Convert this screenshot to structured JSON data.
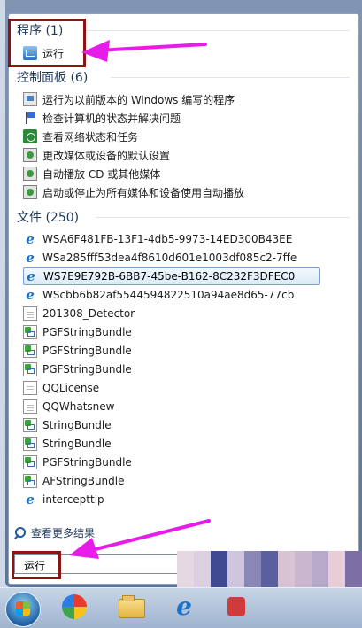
{
  "sections": {
    "programs": {
      "header": "程序 (1)",
      "items": [
        {
          "label": "运行",
          "icon": "run-icon"
        }
      ]
    },
    "control_panel": {
      "header": "控制面板 (6)",
      "items": [
        {
          "label": "运行为以前版本的 Windows 编写的程序",
          "icon": "compat-program-icon"
        },
        {
          "label": "检查计算机的状态并解决问题",
          "icon": "action-center-flag-icon"
        },
        {
          "label": "查看网络状态和任务",
          "icon": "network-icon"
        },
        {
          "label": "更改媒体或设备的默认设置",
          "icon": "autoplay-icon"
        },
        {
          "label": "自动播放 CD 或其他媒体",
          "icon": "autoplay-icon"
        },
        {
          "label": "启动或停止为所有媒体和设备使用自动播放",
          "icon": "autoplay-icon"
        }
      ]
    },
    "files": {
      "header": "文件 (250)",
      "items": [
        {
          "label": "WSA6F481FB-13F1-4db5-9973-14ED300B43EE",
          "icon": "ie-file-icon"
        },
        {
          "label": "WSa285fff53dea4f8610d601e1003df085c2-7ffe",
          "icon": "ie-file-icon"
        },
        {
          "label": "WS7E9E792B-6BB7-45be-B162-8C232F3DFEC0",
          "icon": "ie-file-icon"
        },
        {
          "label": "WScbb6b82af5544594822510a94ae8d65-77cb",
          "icon": "ie-file-icon"
        },
        {
          "label": "201308_Detector",
          "icon": "document-icon"
        },
        {
          "label": "PGFStringBundle",
          "icon": "xml-file-icon"
        },
        {
          "label": "PGFStringBundle",
          "icon": "xml-file-icon"
        },
        {
          "label": "PGFStringBundle",
          "icon": "xml-file-icon"
        },
        {
          "label": "QQLicense",
          "icon": "document-icon"
        },
        {
          "label": "QQWhatsnew",
          "icon": "document-icon"
        },
        {
          "label": "StringBundle",
          "icon": "xml-file-icon"
        },
        {
          "label": "StringBundle",
          "icon": "xml-file-icon"
        },
        {
          "label": "PGFStringBundle",
          "icon": "xml-file-icon"
        },
        {
          "label": "AFStringBundle",
          "icon": "xml-file-icon"
        },
        {
          "label": "intercepttip",
          "icon": "ie-file-icon"
        }
      ]
    }
  },
  "search_more": "查看更多结果",
  "search_box": {
    "value": "运行"
  },
  "colors": {
    "accent_arrow": "#e81ce8",
    "highlight_box": "#8e1313",
    "section_header": "#1e395b"
  },
  "taskbar": {
    "items": [
      {
        "name": "start-orb",
        "icon": "windows-orb-icon"
      },
      {
        "name": "app",
        "icon": "colorful-ball-icon"
      },
      {
        "name": "explorer",
        "icon": "folder-icon"
      },
      {
        "name": "ie",
        "icon": "ie-icon"
      },
      {
        "name": "app",
        "icon": "red-app-icon"
      }
    ]
  }
}
